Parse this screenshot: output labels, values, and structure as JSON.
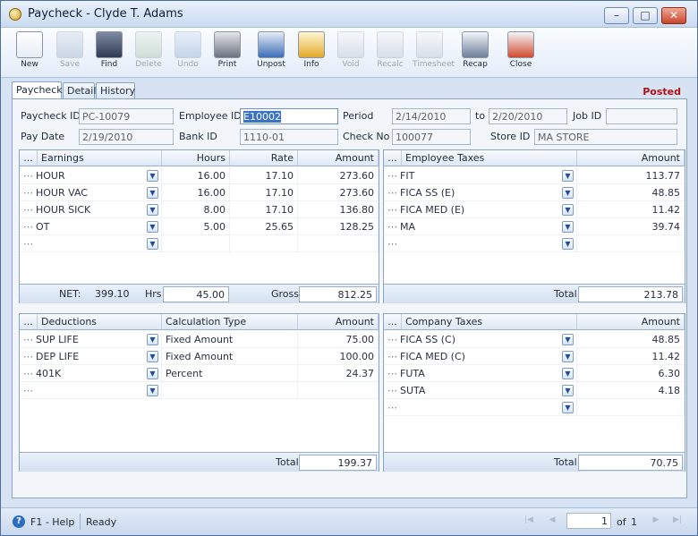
{
  "window": {
    "title": "Paycheck - Clyde T. Adams",
    "minimize": "–",
    "maximize": "□",
    "close": "✕"
  },
  "toolbar": [
    {
      "label": "New",
      "icon": "new-doc-icon",
      "enabled": true
    },
    {
      "label": "Save",
      "icon": "save-icon",
      "enabled": false
    },
    {
      "label": "Find",
      "icon": "binoculars-icon",
      "enabled": true
    },
    {
      "label": "Delete",
      "icon": "recycle-bin-icon",
      "enabled": false
    },
    {
      "label": "Undo",
      "icon": "undo-icon",
      "enabled": false
    },
    {
      "label": "Print",
      "icon": "printer-icon",
      "enabled": true
    },
    {
      "label": "Unpost",
      "icon": "unpost-icon",
      "enabled": true
    },
    {
      "label": "Info",
      "icon": "info-icon",
      "enabled": true
    },
    {
      "label": "Void",
      "icon": "void-icon",
      "enabled": false
    },
    {
      "label": "Recalc",
      "icon": "calculator-icon",
      "enabled": false
    },
    {
      "label": "Timesheet",
      "icon": "timesheet-icon",
      "enabled": false
    },
    {
      "label": "Recap",
      "icon": "recap-icon",
      "enabled": true
    },
    {
      "label": "Close",
      "icon": "close-window-icon",
      "enabled": true
    }
  ],
  "tabs": [
    "Paycheck",
    "Detail",
    "History"
  ],
  "status_badge": "Posted",
  "form": {
    "paycheck_id_label": "Paycheck ID",
    "paycheck_id": "PC-10079",
    "employee_id_label": "Employee ID",
    "employee_id": "E10002",
    "period_label": "Period",
    "period_from": "2/14/2010",
    "period_to_label": "to",
    "period_to": "2/20/2010",
    "job_id_label": "Job ID",
    "job_id": "",
    "pay_date_label": "Pay Date",
    "pay_date": "2/19/2010",
    "bank_id_label": "Bank ID",
    "bank_id": "1110-01",
    "check_no_label": "Check No",
    "check_no": "100077",
    "store_id_label": "Store ID",
    "store_id": "MA STORE"
  },
  "earnings": {
    "headers": {
      "dots": "...",
      "name": "Earnings",
      "hours": "Hours",
      "rate": "Rate",
      "amount": "Amount"
    },
    "rows": [
      {
        "name": "HOUR",
        "hours": "16.00",
        "rate": "17.10",
        "amount": "273.60"
      },
      {
        "name": "HOUR VAC",
        "hours": "16.00",
        "rate": "17.10",
        "amount": "273.60"
      },
      {
        "name": "HOUR SICK",
        "hours": "8.00",
        "rate": "17.10",
        "amount": "136.80"
      },
      {
        "name": "OT",
        "hours": "5.00",
        "rate": "25.65",
        "amount": "128.25"
      },
      {
        "name": "",
        "hours": "",
        "rate": "",
        "amount": ""
      }
    ],
    "footer": {
      "net_label": "NET:",
      "net": "399.10",
      "hrs_label": "Hrs",
      "hrs": "45.00",
      "gross_label": "Gross",
      "gross": "812.25"
    }
  },
  "employee_taxes": {
    "headers": {
      "dots": "...",
      "name": "Employee Taxes",
      "amount": "Amount"
    },
    "rows": [
      {
        "name": "FIT",
        "amount": "113.77"
      },
      {
        "name": "FICA SS (E)",
        "amount": "48.85"
      },
      {
        "name": "FICA MED (E)",
        "amount": "11.42"
      },
      {
        "name": "MA",
        "amount": "39.74"
      },
      {
        "name": "",
        "amount": ""
      }
    ],
    "footer": {
      "total_label": "Total",
      "total": "213.78"
    }
  },
  "deductions": {
    "headers": {
      "dots": "...",
      "name": "Deductions",
      "calc": "Calculation Type",
      "amount": "Amount"
    },
    "rows": [
      {
        "name": "SUP LIFE",
        "calc": "Fixed Amount",
        "amount": "75.00"
      },
      {
        "name": "DEP LIFE",
        "calc": "Fixed Amount",
        "amount": "100.00"
      },
      {
        "name": "401K",
        "calc": "Percent",
        "amount": "24.37"
      },
      {
        "name": "",
        "calc": "",
        "amount": ""
      }
    ],
    "footer": {
      "total_label": "Total",
      "total": "199.37"
    }
  },
  "company_taxes": {
    "headers": {
      "dots": "...",
      "name": "Company Taxes",
      "amount": "Amount"
    },
    "rows": [
      {
        "name": "FICA SS (C)",
        "amount": "48.85"
      },
      {
        "name": "FICA MED (C)",
        "amount": "11.42"
      },
      {
        "name": "FUTA",
        "amount": "6.30"
      },
      {
        "name": "SUTA",
        "amount": "4.18"
      },
      {
        "name": "",
        "amount": ""
      }
    ],
    "footer": {
      "total_label": "Total",
      "total": "70.75"
    }
  },
  "statusbar": {
    "help": "F1 - Help",
    "status": "Ready",
    "page": "1",
    "of_label": "of",
    "total_pages": "1"
  }
}
